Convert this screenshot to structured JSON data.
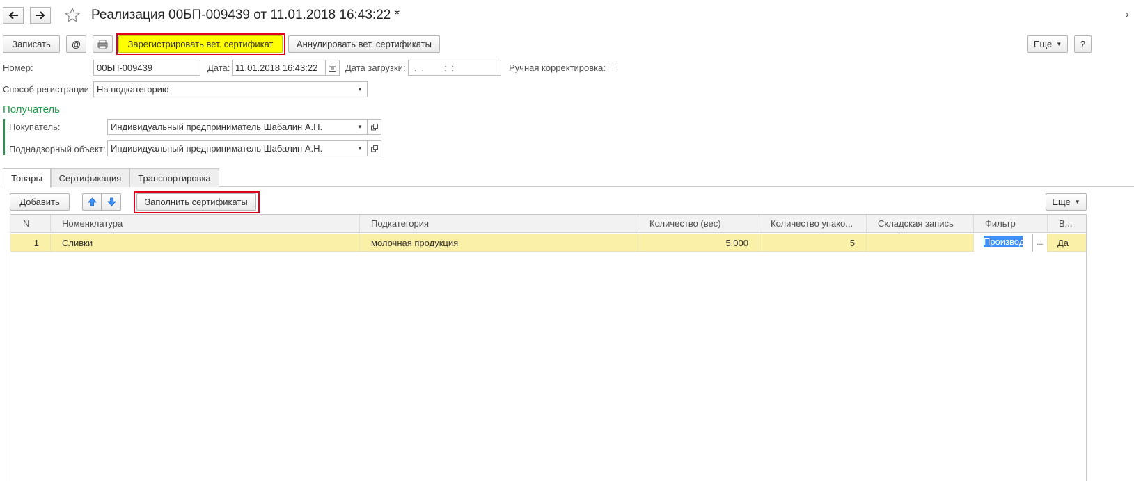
{
  "window": {
    "title": "Реализация 00БП-009439 от 11.01.2018 16:43:22 *"
  },
  "icons": {
    "back": "arrow-left-icon",
    "forward": "arrow-right-icon",
    "favorite": "star-icon",
    "email": "at-sign-icon",
    "print": "printer-icon",
    "close": "chevron-right-icon"
  },
  "toolbar": {
    "save_label": "Записать",
    "email_label": "@",
    "register_label": "Зарегистрировать вет. сертификат",
    "cancel_label": "Аннулировать вет. сертификаты",
    "more_label": "Еще",
    "help_label": "?"
  },
  "form": {
    "number_label": "Номер:",
    "number_value": "00БП-009439",
    "date_label": "Дата:",
    "date_value": "11.01.2018 16:43:22",
    "load_date_label": "Дата загрузки:",
    "load_date_value": " .  .        :  :",
    "manual_label": "Ручная корректировка:",
    "reg_method_label": "Способ регистрации:",
    "reg_method_value": "На подкатегорию"
  },
  "recipient": {
    "section_title": "Получатель",
    "buyer_label": "Покупатель:",
    "buyer_value": "Индивидуальный предприниматель Шабалин А.Н.",
    "object_label": "Поднадзорный объект:",
    "object_value": "Индивидуальный предприниматель Шабалин А.Н."
  },
  "tabs": [
    "Товары",
    "Сертификация",
    "Транспортировка"
  ],
  "table_toolbar": {
    "add_label": "Добавить",
    "fill_label": "Заполнить сертификаты",
    "more_label": "Еще"
  },
  "table": {
    "columns": [
      "N",
      "Номенклатура",
      "Подкатегория",
      "Количество (вес)",
      "Количество упако...",
      "Складская запись",
      "Фильтр",
      "В..."
    ],
    "rows": [
      {
        "n": "1",
        "item": "Сливки",
        "subcategory": "молочная продукция",
        "weight": "5,000",
        "packages": "5",
        "stock": "",
        "filter": "Производ",
        "filter_btn": "...",
        "v": "Да"
      }
    ]
  },
  "colors": {
    "accent_green": "#1f9a48",
    "highlight_yellow": "#ffff00",
    "row_yellow": "#fbf0a7",
    "selection_blue": "#3c8ff5",
    "annotation_red": "#e2001a"
  }
}
